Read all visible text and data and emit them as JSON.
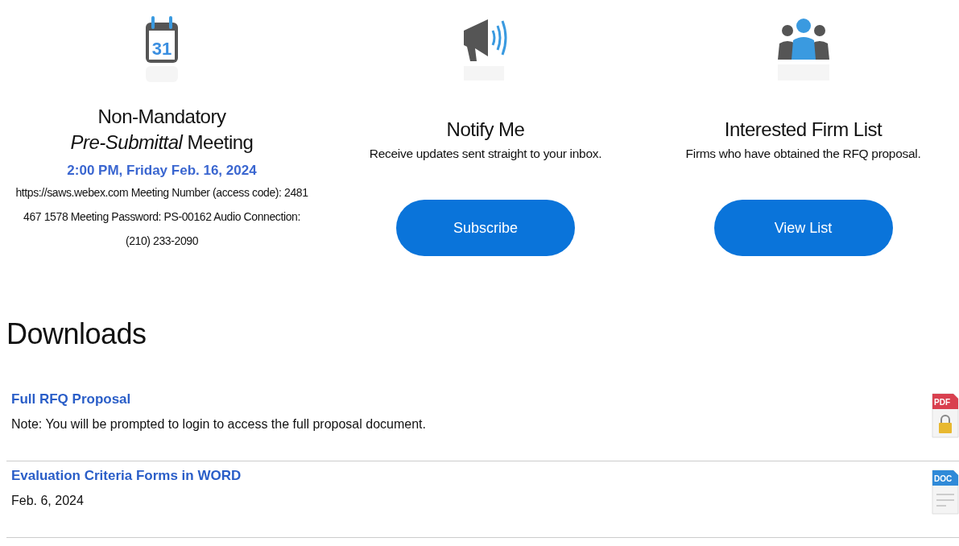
{
  "features": [
    {
      "kind": "meeting",
      "icon_text": "31",
      "title": "Non-Mandatory",
      "subtitle": "*Pre-Submittal* Meeting",
      "date": "2:00 PM, Friday Feb. 16, 2024",
      "details": "https://saws.webex.com Meeting Number (access code): 2481 467 1578 Meeting Password: PS-00162 Audio Connection: (210) 233-2090"
    },
    {
      "kind": "action",
      "title": "Notify Me",
      "description": "Receive updates sent straight to your inbox.",
      "button": "Subscribe"
    },
    {
      "kind": "action",
      "title": "Interested Firm List",
      "description": "Firms who have obtained the RFQ proposal.",
      "button": "View List"
    }
  ],
  "downloads": {
    "title": "Downloads",
    "items": [
      {
        "link": "Full RFQ Proposal",
        "note": "Note: You will be prompted to login to access the full proposal document.",
        "file_type": "PDF",
        "color": "#d9404f",
        "locked": true
      },
      {
        "link": "Evaluation Criteria Forms in WORD",
        "note": "Feb. 6, 2024",
        "file_type": "DOC",
        "color": "#2f8ad8",
        "locked": false
      }
    ]
  }
}
